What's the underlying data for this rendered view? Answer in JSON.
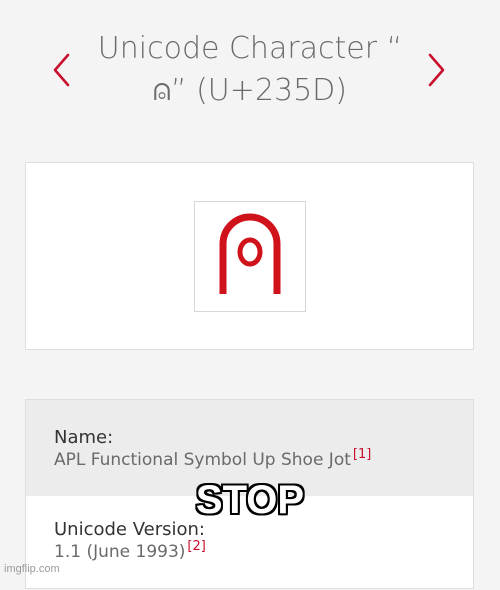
{
  "header": {
    "title_line1": "Unicode Character “",
    "title_line2": "⍝” (U+235D)"
  },
  "glyph": {
    "char": "⍝",
    "codepoint": "U+235D",
    "color": "#d0121b"
  },
  "info": {
    "name_label": "Name:",
    "name_value": "APL Functional Symbol Up Shoe Jot",
    "name_ref": "[1]",
    "version_label": "Unicode Version:",
    "version_value": "1.1 (June 1993)",
    "version_ref": "[2]"
  },
  "overlay": {
    "caption": "STOP",
    "watermark": "imgflip.com"
  },
  "colors": {
    "accent": "#c8102e",
    "background": "#f4f4f4"
  },
  "icons": [
    "chevron-left-icon",
    "chevron-right-icon"
  ]
}
